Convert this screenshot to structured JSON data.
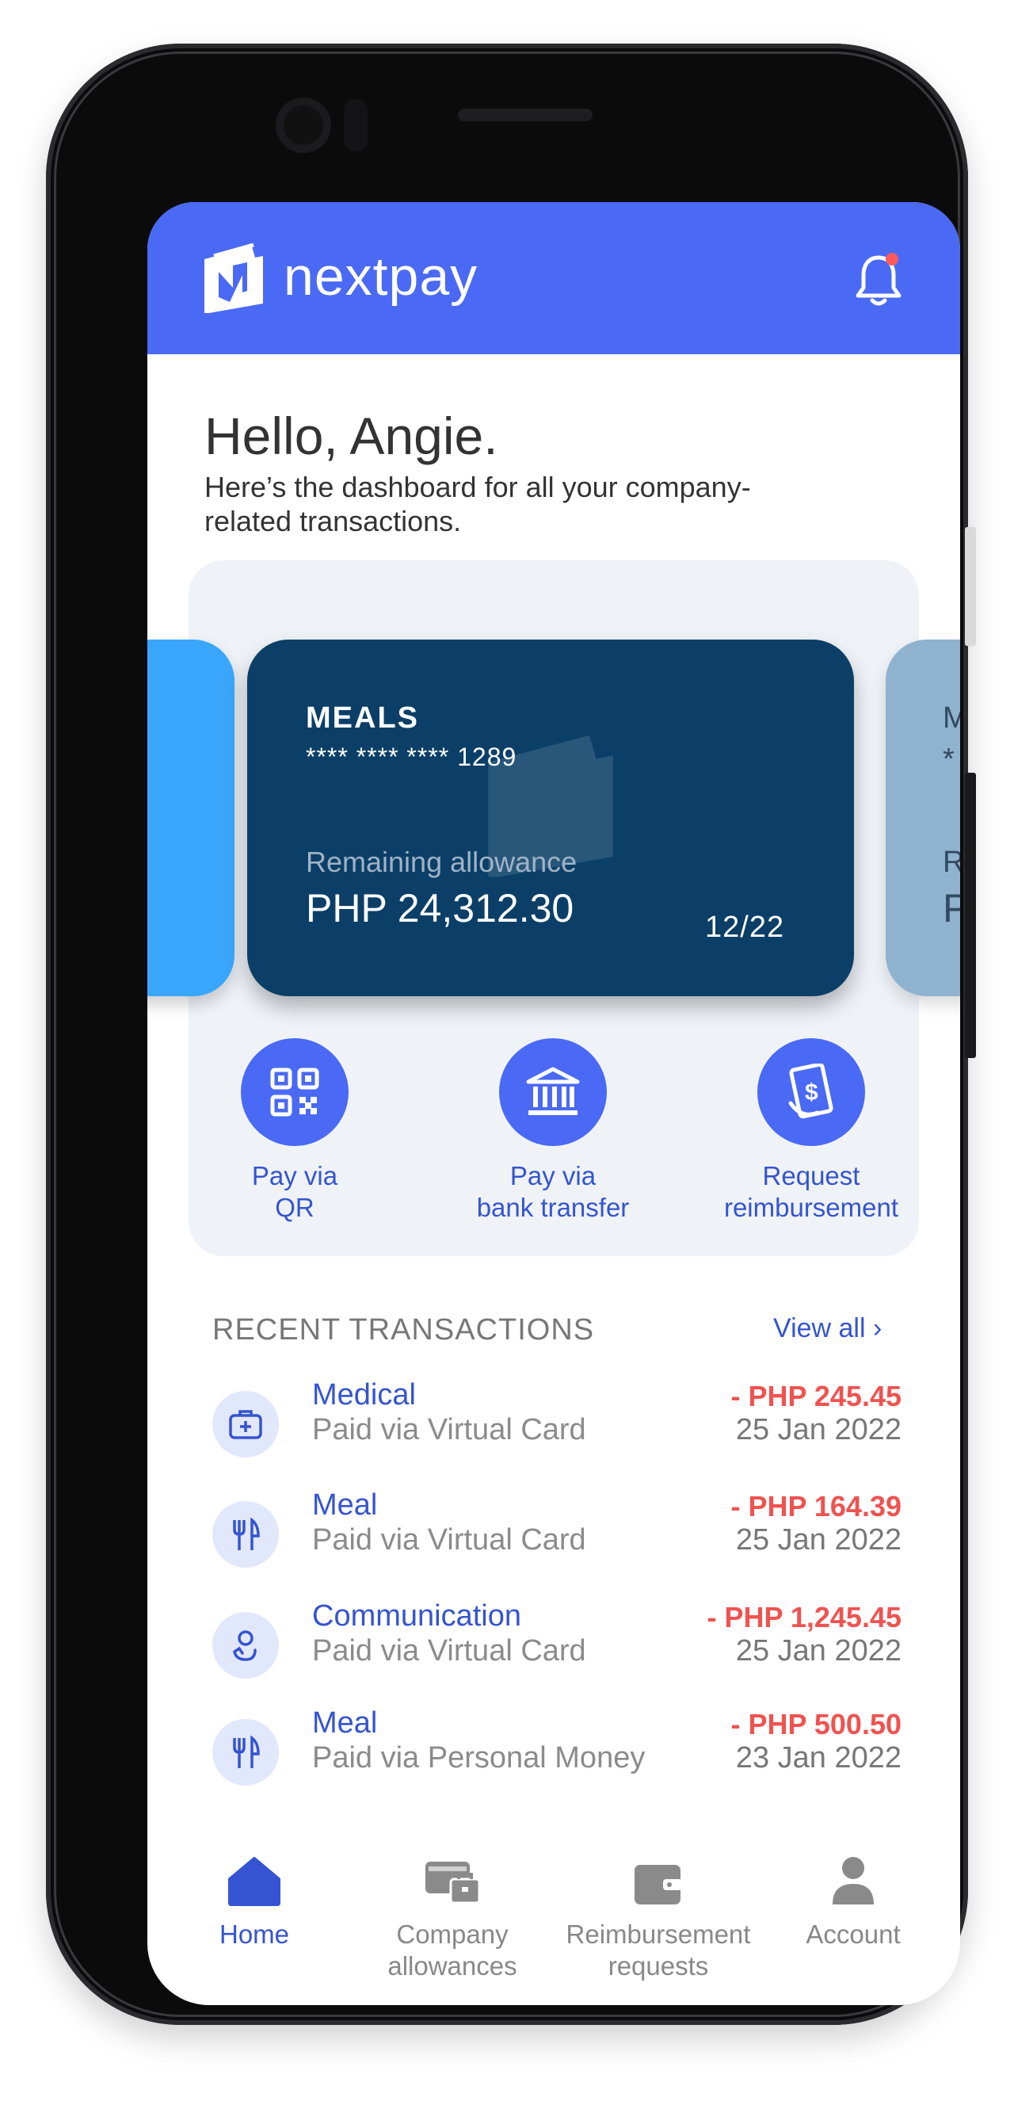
{
  "brand": {
    "name": "nextpay"
  },
  "greeting": {
    "title": "Hello, Angie.",
    "subtitle": "Here’s the dashboard for all your company-related transactions."
  },
  "cards": {
    "current": {
      "name": "MEALS",
      "number": "**** **** **** 1289",
      "remaining_label": "Remaining allowance",
      "balance": "PHP 24,312.30",
      "expiry": "12/22"
    },
    "next_peek": {
      "name_initial": "M",
      "number_initial": "*",
      "label_initial": "R",
      "balance_initial": "P"
    }
  },
  "actions": [
    {
      "label_line1": "Pay via",
      "label_line2": "QR",
      "icon": "qr-code-icon"
    },
    {
      "label_line1": "Pay via",
      "label_line2": "bank transfer",
      "icon": "bank-icon"
    },
    {
      "label_line1": "Request",
      "label_line2": "reimbursement",
      "icon": "reimbursement-icon"
    }
  ],
  "recent": {
    "title": "RECENT TRANSACTIONS",
    "view_all": "View all ›",
    "items": [
      {
        "category": "Medical",
        "method": "Paid via Virtual Card",
        "amount": "- PHP 245.45",
        "date": "25 Jan 2022",
        "icon": "medical-kit-icon"
      },
      {
        "category": "Meal",
        "method": "Paid via Virtual Card",
        "amount": "- PHP 164.39",
        "date": "25 Jan 2022",
        "icon": "fork-knife-icon"
      },
      {
        "category": "Communication",
        "method": "Paid via Virtual Card",
        "amount": "- PHP 1,245.45",
        "date": "25 Jan 2022",
        "icon": "communication-icon"
      },
      {
        "category": "Meal",
        "method": "Paid via Personal Money",
        "amount": "- PHP 500.50",
        "date": "23 Jan 2022",
        "icon": "fork-knife-icon"
      }
    ]
  },
  "nav": [
    {
      "line1": "Home",
      "line2": "",
      "icon": "home-icon",
      "active": true
    },
    {
      "line1": "Company",
      "line2": "allowances",
      "icon": "wallet-briefcase-icon",
      "active": false
    },
    {
      "line1": "Reimbursement",
      "line2": "requests",
      "icon": "wallet-icon",
      "active": false
    },
    {
      "line1": "Account",
      "line2": "",
      "icon": "user-icon",
      "active": false
    }
  ],
  "colors": {
    "primary": "#4a69f5",
    "card": "#0b3f67",
    "negative": "#ef5350",
    "link": "#3554d1"
  }
}
